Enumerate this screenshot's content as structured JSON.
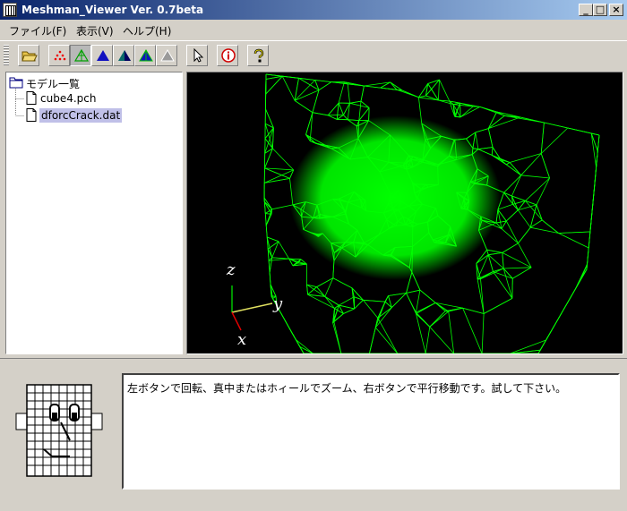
{
  "window": {
    "title": "Meshman_Viewer Ver. 0.7beta",
    "controls": {
      "minimize": "_",
      "maximize": "□",
      "close": "×"
    }
  },
  "menu": {
    "items": [
      {
        "label": "ファイル(F)"
      },
      {
        "label": "表示(V)"
      },
      {
        "label": "ヘルプ(H)"
      }
    ]
  },
  "toolbar": {
    "buttons": [
      {
        "icon": "open-folder-icon"
      },
      {
        "icon": "points-icon"
      },
      {
        "icon": "wireframe-icon"
      },
      {
        "icon": "solid-icon"
      },
      {
        "icon": "shaded-icon"
      },
      {
        "icon": "shaded-edges-icon"
      },
      {
        "icon": "gray-icon"
      },
      {
        "icon": "cursor-icon"
      },
      {
        "icon": "info-icon"
      },
      {
        "icon": "help-icon"
      }
    ]
  },
  "model_tree": {
    "root_label": "モデル一覧",
    "items": [
      {
        "label": "cube4.pch",
        "selected": false
      },
      {
        "label": "dforcCrack.dat",
        "selected": true
      }
    ]
  },
  "viewport": {
    "background": "#000000",
    "mesh_color": "#00ff00",
    "axes": {
      "z": "z",
      "y": "y",
      "x": "x"
    }
  },
  "message": {
    "text": "左ボタンで回転、真中またはホィールでズーム、右ボタンで平行移動です。試して下さい。"
  },
  "colors": {
    "accent_title": "#0a246a",
    "selection": "#c0c0e8"
  }
}
